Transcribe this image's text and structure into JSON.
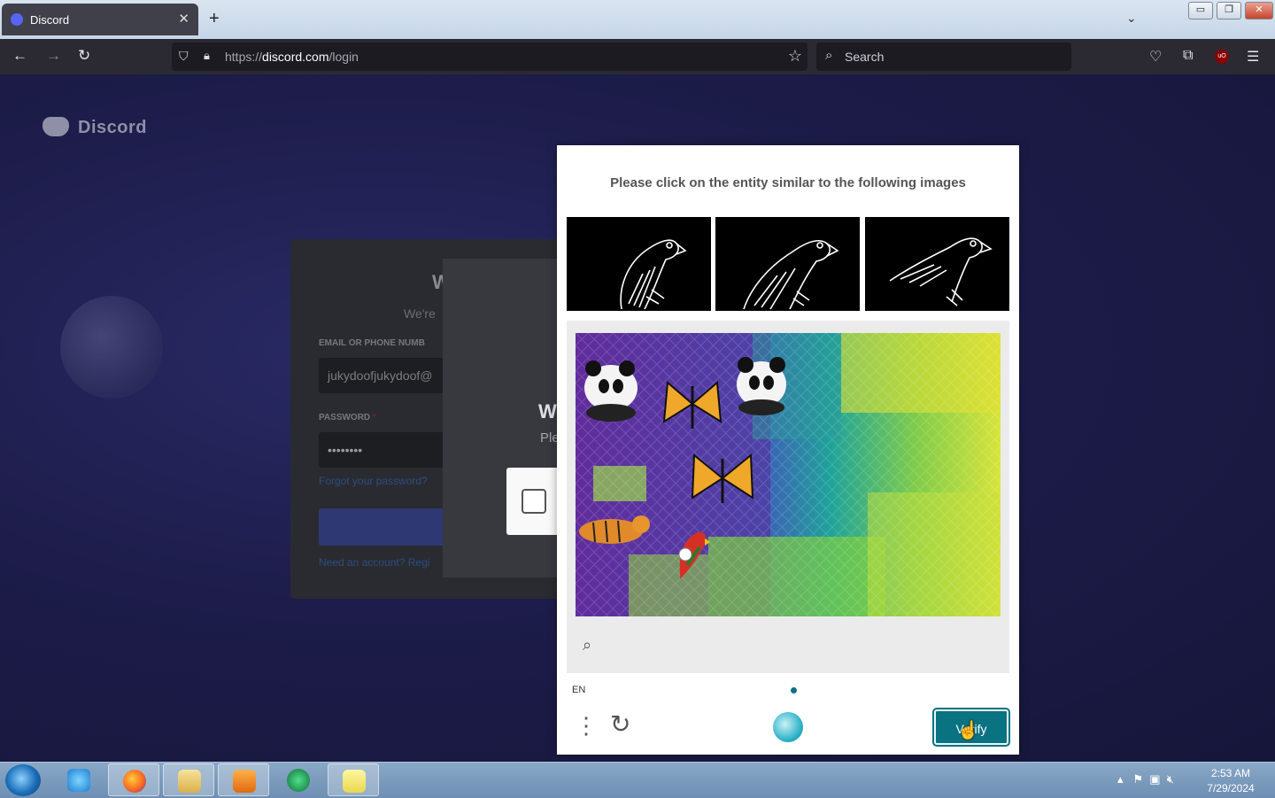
{
  "browser": {
    "tab_title": "Discord",
    "tab_close": "✕",
    "new_tab": "+",
    "tab_list": "⌄",
    "win_minimize": "▭",
    "win_restore": "❐",
    "win_close": "✕",
    "url_scheme": "https://",
    "url_domain": "discord.com",
    "url_path": "/login",
    "search_placeholder": "Search",
    "ublock_label": "uO"
  },
  "page": {
    "logo_text": "Discord",
    "login": {
      "title": "W",
      "subtitle": "We're",
      "email_label": "EMAIL OR PHONE NUMB",
      "email_value": "jukydoofjukydoof@",
      "password_label": "PASSWORD",
      "password_required": "*",
      "password_value": "••••••••",
      "forgot_link": "Forgot your password?",
      "register_prompt": "Need an account?",
      "register_link": "Regi"
    },
    "hcaptcha_overlay": {
      "title": "W",
      "text": "Ple"
    }
  },
  "challenge": {
    "prompt": "Please click on the entity similar to the following images",
    "example_images": [
      "parrot-sketch-1",
      "parrot-sketch-2",
      "parrot-sketch-3"
    ],
    "task_entities": [
      "panda",
      "butterfly",
      "panda",
      "butterfly",
      "tiger",
      "parrot"
    ],
    "language": "EN",
    "verify_label": "Verify",
    "menu_icon": "⋮",
    "refresh_icon": "↻",
    "accent_color": "#0a7381"
  },
  "taskbar": {
    "clock_time": "2:53 AM",
    "clock_date": "7/29/2024"
  }
}
